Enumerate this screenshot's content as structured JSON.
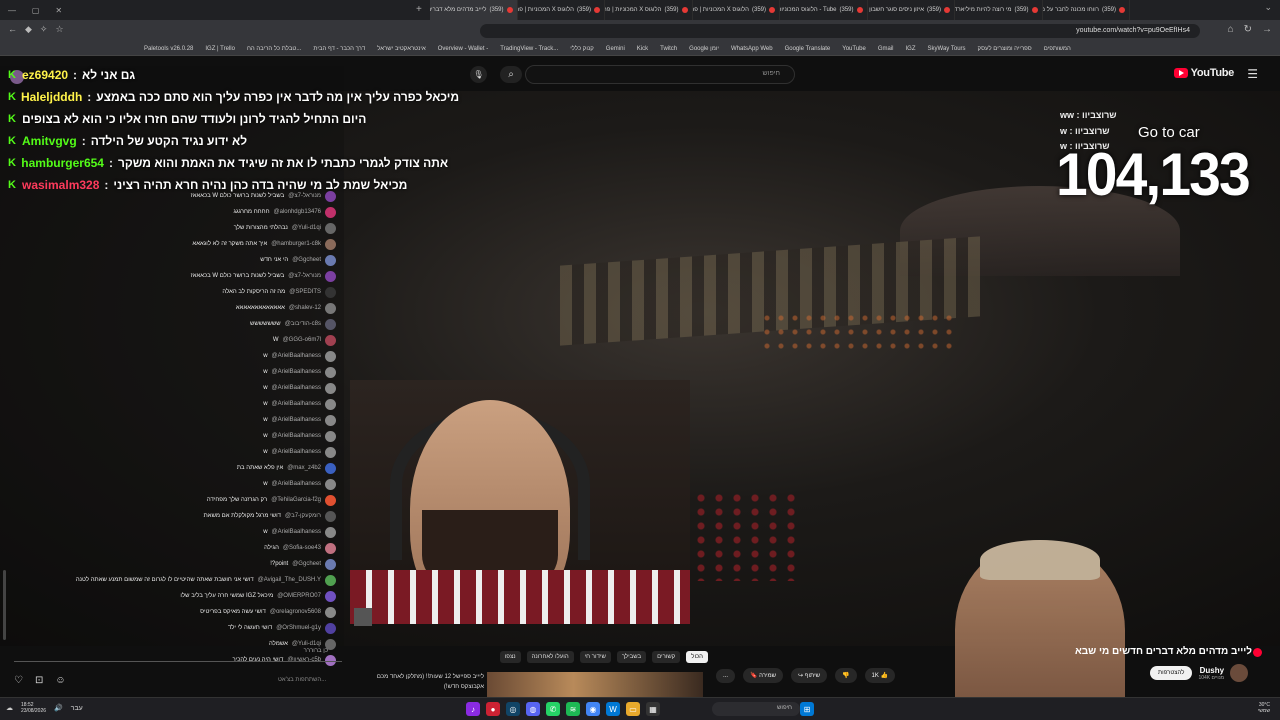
{
  "browser": {
    "tabs": [
      {
        "label": "ליייב מדהים מלא דברים חדשים מי שבא",
        "count": "(359)",
        "active": true,
        "recording": true
      },
      {
        "label": "הלוגוס X המכוניות | פרוק",
        "count": "(359)",
        "active": false,
        "recording": true
      },
      {
        "label": "הלוגוס X המכוניות | פרוק",
        "count": "(359)",
        "active": false,
        "recording": true
      },
      {
        "label": "הלוגוס X המכוניות | פרוק",
        "count": "(359)",
        "active": false,
        "recording": true
      },
      {
        "label": "Tube - הלוגוס המכוניות",
        "count": "(359)",
        "active": false,
        "recording": true
      },
      {
        "label": "איזון ניסים סוגר חשבון עם",
        "count": "(359)",
        "active": false,
        "recording": true
      },
      {
        "label": "מי רוצה להיות מיליארדר",
        "count": "(359)",
        "active": false,
        "recording": true
      },
      {
        "label": "רווחו מכונה לחבר על מה הריב",
        "count": "(359)",
        "active": false,
        "recording": true
      }
    ],
    "url": "youtube.com/watch?v=pu9OeEfIHs4",
    "bookmarks": [
      "Paletools v26.0.28",
      "IGZ | Trello",
      "טבלת כל הריבה הח...",
      "דרך הכבר - דף הבית",
      "אינטראקטיב ישראל",
      "Overview - Wallet -",
      "TradingView - Track...",
      "קנוק כללי",
      "Gemini",
      "Kick",
      "Twitch",
      "Google יומן",
      "WhatsApp Web",
      "Google Translate",
      "YouTube",
      "Gmail",
      "IGZ",
      "SkyWay Tours",
      "ספרייה ומוצרים לעסק",
      "המשותפים"
    ]
  },
  "youtube": {
    "logo_text": "YouTube",
    "search_placeholder": "חיפוש"
  },
  "pinned_chat": [
    {
      "user": "ez69420",
      "message": "גם אני לא",
      "color": "yel"
    },
    {
      "user": "Haleljdddh",
      "message": "מיכאל כפרה עליך אין מה לדבר אין כפרה עליך הוא סתם ככה באמצע",
      "color": "yel"
    },
    {
      "user": "",
      "message": "היום התחיל להגיד לרונן ולעודד שהם חזרו אליו כי הוא לא בצופים",
      "color": ""
    },
    {
      "user": "Amitvgvg",
      "message": "לא ידוע נגיד הקטע של הילדה",
      "color": ""
    },
    {
      "user": "hamburger654",
      "message": "אתה צודק לגמרי כתבתי לו את זה שיגיד את האמת והוא משקר",
      "color": ""
    },
    {
      "user": "wasimalm328",
      "message": "מכיאל שמת לב מי שהיה בדה כהן נהיה חרא תהיה רציני",
      "color": "red"
    }
  ],
  "chat_messages": [
    {
      "user": "@מנוראל-7צ",
      "text": "בשביל לשנות ברושר כולם W בכאאאז",
      "avatar": "#7b3fa0"
    },
    {
      "user": "@alonhdgb13476",
      "text": "חחחח מחרגגג",
      "avatar": "#c0306a"
    },
    {
      "user": "@Yuli-d1qi",
      "text": "נבהלתי מהצורות שלך",
      "avatar": "#666"
    },
    {
      "user": "@hamburger1-c8k",
      "text": "איך אתה משקר זה לא לוגאאא",
      "avatar": "#8a6a5a"
    },
    {
      "user": "@Ggcheet",
      "text": "הי אני חדש",
      "avatar": "#6a7ab0"
    },
    {
      "user": "@מנוראל-7צ",
      "text": "בשביל לשנות ברושר כולם W בכאאאז",
      "avatar": "#7b3fa0"
    },
    {
      "user": "@SPEDITS",
      "text": "מה זה הריסקות לב האלה",
      "avatar": "#333"
    },
    {
      "user": "@shalev-12",
      "text": "אאאאאאאאאאאאא",
      "avatar": "#777"
    },
    {
      "user": "@הודיבוב-c8s",
      "text": "ששששששש",
      "avatar": "#556"
    },
    {
      "user": "@GGG-o6m7l",
      "text": "W",
      "avatar": "#a04050"
    },
    {
      "user": "@ArielBaalhaness",
      "text": "w",
      "avatar": "#888"
    },
    {
      "user": "@ArielBaalhaness",
      "text": "w",
      "avatar": "#888"
    },
    {
      "user": "@ArielBaalhaness",
      "text": "w",
      "avatar": "#888"
    },
    {
      "user": "@ArielBaalhaness",
      "text": "w",
      "avatar": "#888"
    },
    {
      "user": "@ArielBaalhaness",
      "text": "w",
      "avatar": "#888"
    },
    {
      "user": "@ArielBaalhaness",
      "text": "w",
      "avatar": "#888"
    },
    {
      "user": "@ArielBaalhaness",
      "text": "w",
      "avatar": "#888"
    },
    {
      "user": "@max_z4b2",
      "text": "אין פלא שאתה בת",
      "avatar": "#3a60c0"
    },
    {
      "user": "@ArielBaalhaness",
      "text": "w",
      "avatar": "#888"
    },
    {
      "user": "@TehilaGarcia-f2g",
      "text": "רק הגרזנה שלך מפחידה",
      "avatar": "#e05030"
    },
    {
      "user": "@רומקעקן-7ב",
      "text": "דושי מרגל מקולקלת אם משאת",
      "avatar": "#555"
    },
    {
      "user": "@ArielBaalhaness",
      "text": "w",
      "avatar": "#888"
    },
    {
      "user": "@Sofia-soe43",
      "text": "הגילה",
      "avatar": "#c07080"
    },
    {
      "user": "@Ggcheet",
      "text": "point?!",
      "avatar": "#6a7ab0"
    },
    {
      "user": "@Avigail_The_DUSH.Y",
      "text": "דושי אני חושבת שאתה שהיטיים לו לגרום זה שמשום תמנע שאתה לטנה",
      "avatar": "#50a050"
    },
    {
      "user": "@OMERPRO07",
      "text": "מיכאל IGZ שמשי חרה עליך בליב שלו",
      "avatar": "#7050c0"
    },
    {
      "user": "@orelagronov5608",
      "text": "דושי עשה מאיקס בפריטיס",
      "avatar": "#888"
    },
    {
      "user": "@OrShmuel-g1y",
      "text": "דושי תעשה לי ילד",
      "avatar": "#5040a0"
    },
    {
      "user": "@Yuli-d1qi",
      "text": "אשמלה",
      "avatar": "#666"
    },
    {
      "user": "@ראשיון-c5b",
      "text": "דושי היה נעים להכיר",
      "avatar": "#a070c0"
    }
  ],
  "chat_input_placeholder": "כן ברוררר",
  "chat_footer": "השתתפות בצ'אט...",
  "overlay": {
    "subs_list": [
      "ww : שרוצביוו",
      "w : שרוצביוו",
      "w : שרוצביוו"
    ],
    "goto_text": "Go to car",
    "counter": "104,133"
  },
  "chips": [
    "הכול",
    "קשורים",
    "בשבילך",
    "שידור חי",
    "הועלו לאחרונה",
    "נצפו"
  ],
  "reco": {
    "title": "ליייב ספיישל 12 שעות!! (מתלקן לאחד מכם אקבוצקס חדש!)"
  },
  "video_title": "ליייב מדהים מלא דברים חדשים מי שבא",
  "channel": {
    "name": "Dushy",
    "subs": "104K מנויים",
    "subscribe_label": "להצטרפות"
  },
  "actions": {
    "like": "1K",
    "share": "שיתוף",
    "save": "שמירה",
    "more": "..."
  },
  "taskbar": {
    "time": "18:52",
    "date": "23/08/2026",
    "weather": "30°C",
    "weather_desc": "שמשי",
    "search": "חיפוש",
    "lang": "עבר"
  },
  "colors": {
    "accent": "#ff0033",
    "kick_green": "#53fc18"
  }
}
